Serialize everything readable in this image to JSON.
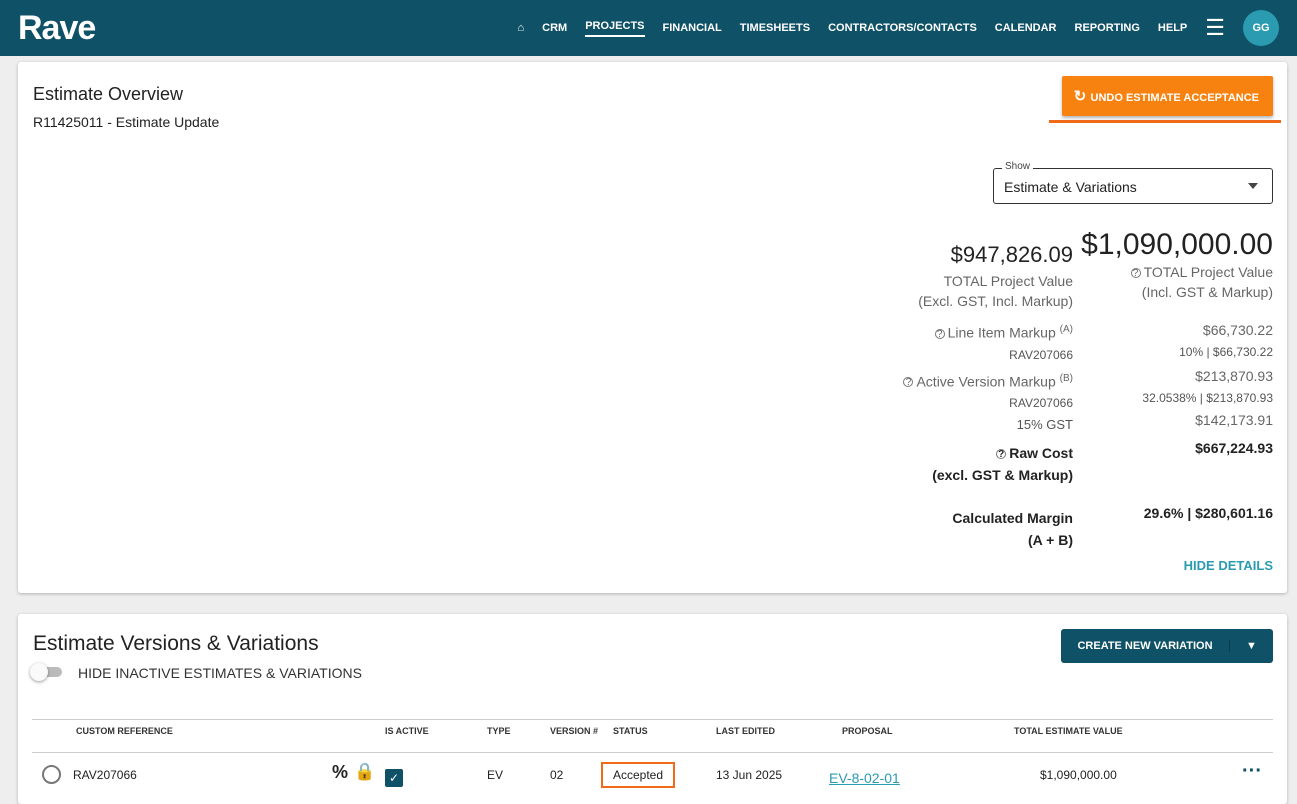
{
  "app": {
    "logo": "Rave",
    "nav": [
      "CRM",
      "PROJECTS",
      "FINANCIAL",
      "TIMESHEETS",
      "CONTRACTORS/CONTACTS",
      "CALENDAR",
      "REPORTING",
      "HELP"
    ],
    "avatar": "GG"
  },
  "overview": {
    "title": "Estimate Overview",
    "subtitle": "R11425011 - Estimate Update",
    "undo": "UNDO ESTIMATE ACCEPTANCE",
    "show_label": "Show",
    "show_value": "Estimate & Variations",
    "excl_value": "$947,826.09",
    "excl_l1": "TOTAL Project Value",
    "excl_l2": "(Excl. GST, Incl. Markup)",
    "incl_value": "$1,090,000.00",
    "incl_l1": "TOTAL Project Value",
    "incl_l2": "(Incl. GST & Markup)",
    "lim_label": "Line Item Markup",
    "lim_sup": "(A)",
    "lim_value": "$66,730.22",
    "lim_ref": "RAV207066",
    "lim_detail": "10% | $66,730.22",
    "avm_label": "Active Version Markup",
    "avm_sup": "(B)",
    "avm_value": "$213,870.93",
    "avm_ref": "RAV207066",
    "avm_detail": "32.0538% | $213,870.93",
    "gst_label": "15% GST",
    "gst_value": "$142,173.91",
    "raw_l1": "Raw Cost",
    "raw_l2": "(excl. GST & Markup)",
    "raw_value": "$667,224.93",
    "margin_l1": "Calculated Margin",
    "margin_l2": "(A + B)",
    "margin_value": "29.6% | $280,601.16",
    "hide": "HIDE DETAILS"
  },
  "versions": {
    "title": "Estimate Versions & Variations",
    "toggle": "HIDE INACTIVE ESTIMATES & VARIATIONS",
    "create": "CREATE NEW VARIATION",
    "headers": [
      "CUSTOM REFERENCE",
      "IS ACTIVE",
      "TYPE",
      "VERSION #",
      "STATUS",
      "LAST EDITED",
      "PROPOSAL",
      "TOTAL ESTIMATE VALUE"
    ],
    "row": {
      "ref": "RAV207066",
      "type": "EV",
      "version": "02",
      "status": "Accepted",
      "edited": "13 Jun 2025",
      "proposal": "EV-8-02-01",
      "total": "$1,090,000.00"
    }
  }
}
